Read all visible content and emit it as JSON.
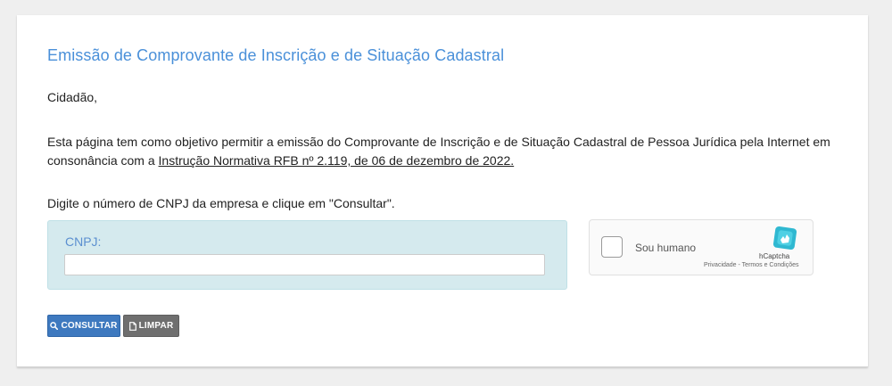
{
  "page": {
    "title": "Emissão de Comprovante de Inscrição e de Situação Cadastral",
    "greeting": "Cidadão,",
    "description_pre": "Esta página tem como objetivo permitir a emissão do Comprovante de Inscrição e de Situação Cadastral de Pessoa Jurídica pela Internet em consonância com a ",
    "description_link": "Instrução Normativa RFB nº 2.119, de 06 de dezembro de 2022.",
    "instruction": "Digite o número de CNPJ da empresa e clique em \"Consultar\"."
  },
  "form": {
    "cnpj_label": "CNPJ:",
    "cnpj_value": "",
    "cnpj_placeholder": ""
  },
  "captcha": {
    "label": "Sou humano",
    "brand": "hCaptcha",
    "links": "Privacidade - Termos e Condições",
    "checked": false
  },
  "buttons": {
    "consultar": "CONSULTAR",
    "limpar": "LIMPAR"
  },
  "icons": {
    "consultar": "search-icon",
    "limpar": "file-icon",
    "captcha": "hcaptcha-logo-icon"
  },
  "colors": {
    "title": "#4a90d9",
    "cnpj_panel": "#d5eaee",
    "consultar_button": "#3e79bf",
    "limpar_button": "#6f6f6f"
  }
}
